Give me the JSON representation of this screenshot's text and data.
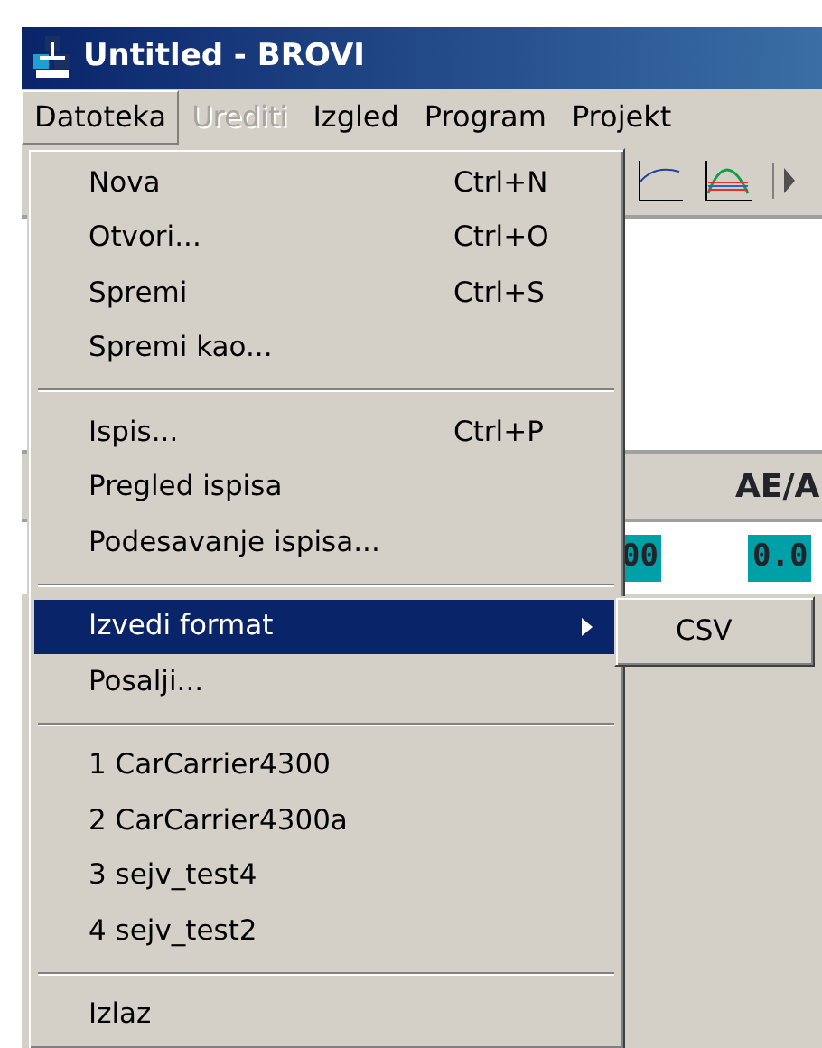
{
  "window": {
    "title": "Untitled - BROVI"
  },
  "menu_bar": [
    {
      "label": "Datoteka",
      "selected": true,
      "disabled": false
    },
    {
      "label": "Urediti",
      "selected": false,
      "disabled": true
    },
    {
      "label": "Izgled",
      "selected": false,
      "disabled": false
    },
    {
      "label": "Program",
      "selected": false,
      "disabled": false
    },
    {
      "label": "Projekt",
      "selected": false,
      "disabled": false
    }
  ],
  "table": {
    "header": [
      "AE/A"
    ],
    "row": [
      "00",
      "0.0"
    ]
  },
  "file_menu": {
    "items": [
      {
        "kind": "item",
        "label": "Nova",
        "shortcut": "Ctrl+N",
        "selected": false
      },
      {
        "kind": "item",
        "label": "Otvori...",
        "shortcut": "Ctrl+O",
        "selected": false
      },
      {
        "kind": "item",
        "label": "Spremi",
        "shortcut": "Ctrl+S",
        "selected": false
      },
      {
        "kind": "item",
        "label": "Spremi kao...",
        "selected": false
      },
      {
        "kind": "separator"
      },
      {
        "kind": "item",
        "label": "Ispis...",
        "shortcut": "Ctrl+P",
        "selected": false
      },
      {
        "kind": "item",
        "label": "Pregled ispisa",
        "selected": false
      },
      {
        "kind": "item",
        "label": "Podesavanje ispisa...",
        "selected": false
      },
      {
        "kind": "separator"
      },
      {
        "kind": "submenu",
        "label": "Izvedi format",
        "selected": true
      },
      {
        "kind": "item",
        "label": "Posalji...",
        "selected": false
      },
      {
        "kind": "separator"
      },
      {
        "kind": "item",
        "label": "1 CarCarrier4300",
        "selected": false
      },
      {
        "kind": "item",
        "label": "2 CarCarrier4300a",
        "selected": false
      },
      {
        "kind": "item",
        "label": "3 sejv_test4",
        "selected": false
      },
      {
        "kind": "item",
        "label": "4 sejv_test2",
        "selected": false
      },
      {
        "kind": "separator"
      },
      {
        "kind": "item",
        "label": "Izlaz",
        "selected": false
      }
    ]
  },
  "submenu": {
    "items": [
      {
        "label": "CSV",
        "selected": false
      }
    ]
  }
}
